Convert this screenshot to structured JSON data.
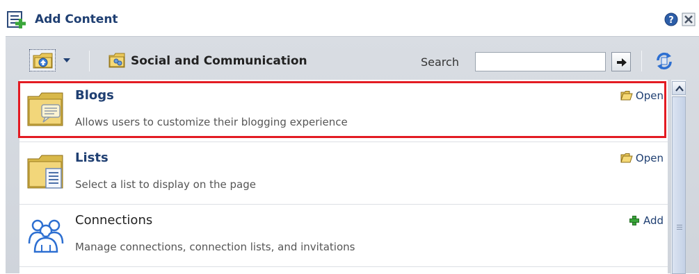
{
  "dialog": {
    "title": "Add Content",
    "help_icon": "help-icon",
    "close_icon": "close-icon"
  },
  "toolbar": {
    "category": "Social and Communication",
    "search_label": "Search",
    "search_value": "",
    "search_placeholder": ""
  },
  "items": [
    {
      "title": "Blogs",
      "description": "Allows users to customize their blogging experience",
      "action": "Open",
      "icon": "folder-blog-icon",
      "highlighted": true
    },
    {
      "title": "Lists",
      "description": "Select a list to display on the page",
      "action": "Open",
      "icon": "folder-list-icon",
      "highlighted": false
    },
    {
      "title": "Connections",
      "description": "Manage connections, connection lists, and invitations",
      "action": "Add",
      "icon": "people-icon",
      "highlighted": false
    }
  ],
  "colors": {
    "accent": "#1f3f72",
    "highlight": "#e31b23",
    "toolbar_bg": "#d3d8df"
  }
}
